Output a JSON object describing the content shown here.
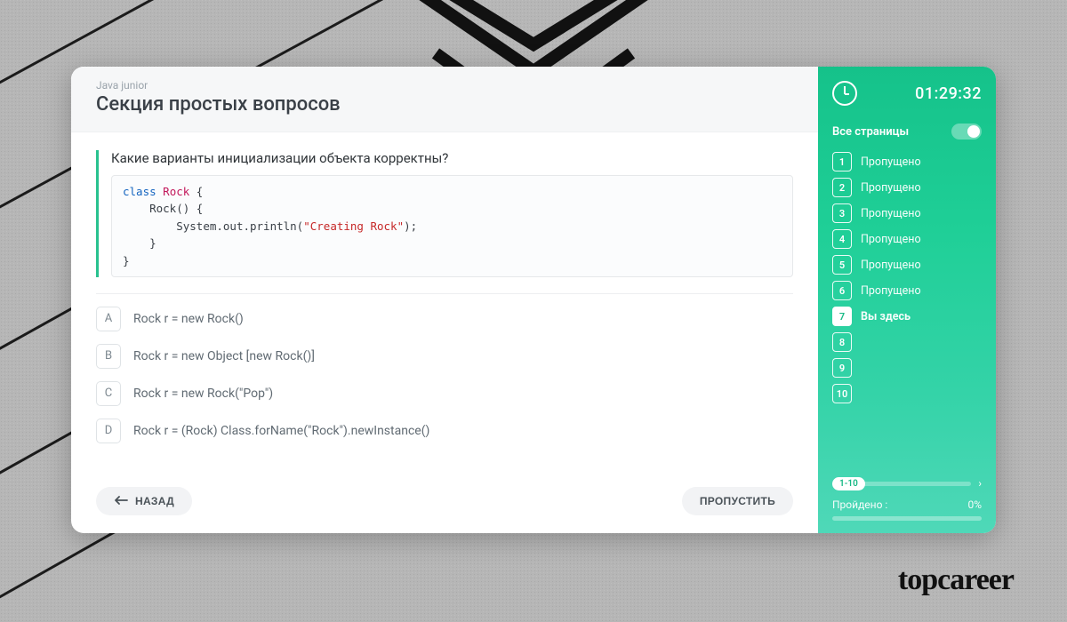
{
  "header": {
    "breadcrumb": "Java junior",
    "section_title": "Секция простых вопросов"
  },
  "question": {
    "text": "Какие варианты инициализации объекта корректны?",
    "code": {
      "kw_class": "class",
      "cls_name": "Rock",
      "open1": " {",
      "line2_indent": "    ",
      "ctor": "Rock() {",
      "line3_indent": "        ",
      "print_prefix": "System.out.println(",
      "str": "\"Creating Rock\"",
      "print_suffix": ");",
      "line4_indent": "    ",
      "close_inner": "}",
      "close_outer": "}"
    }
  },
  "options": [
    {
      "letter": "A",
      "text": "Rock r = new Rock()"
    },
    {
      "letter": "B",
      "text": "Rock r = new Object [new Rock()]"
    },
    {
      "letter": "C",
      "text": "Rock r = new Rock(\"Pop\")"
    },
    {
      "letter": "D",
      "text": "Rock r = (Rock) Class.forName(\"Rock\").newInstance()"
    }
  ],
  "footer": {
    "back_label": "НАЗАД",
    "skip_label": "ПРОПУСТИТЬ"
  },
  "sidebar": {
    "timer": "01:29:32",
    "all_pages_label": "Все страницы",
    "pages": [
      {
        "n": "1",
        "label": "Пропущено",
        "current": false
      },
      {
        "n": "2",
        "label": "Пропущено",
        "current": false
      },
      {
        "n": "3",
        "label": "Пропущено",
        "current": false
      },
      {
        "n": "4",
        "label": "Пропущено",
        "current": false
      },
      {
        "n": "5",
        "label": "Пропущено",
        "current": false
      },
      {
        "n": "6",
        "label": "Пропущено",
        "current": false
      },
      {
        "n": "7",
        "label": "Вы здесь",
        "current": true
      },
      {
        "n": "8",
        "label": "",
        "current": false
      },
      {
        "n": "9",
        "label": "",
        "current": false
      },
      {
        "n": "10",
        "label": "",
        "current": false
      }
    ],
    "range_label": "1-10",
    "progress_label": "Пройдено :",
    "progress_value": "0%",
    "progress_pct": 0
  },
  "brand": "topcareer"
}
